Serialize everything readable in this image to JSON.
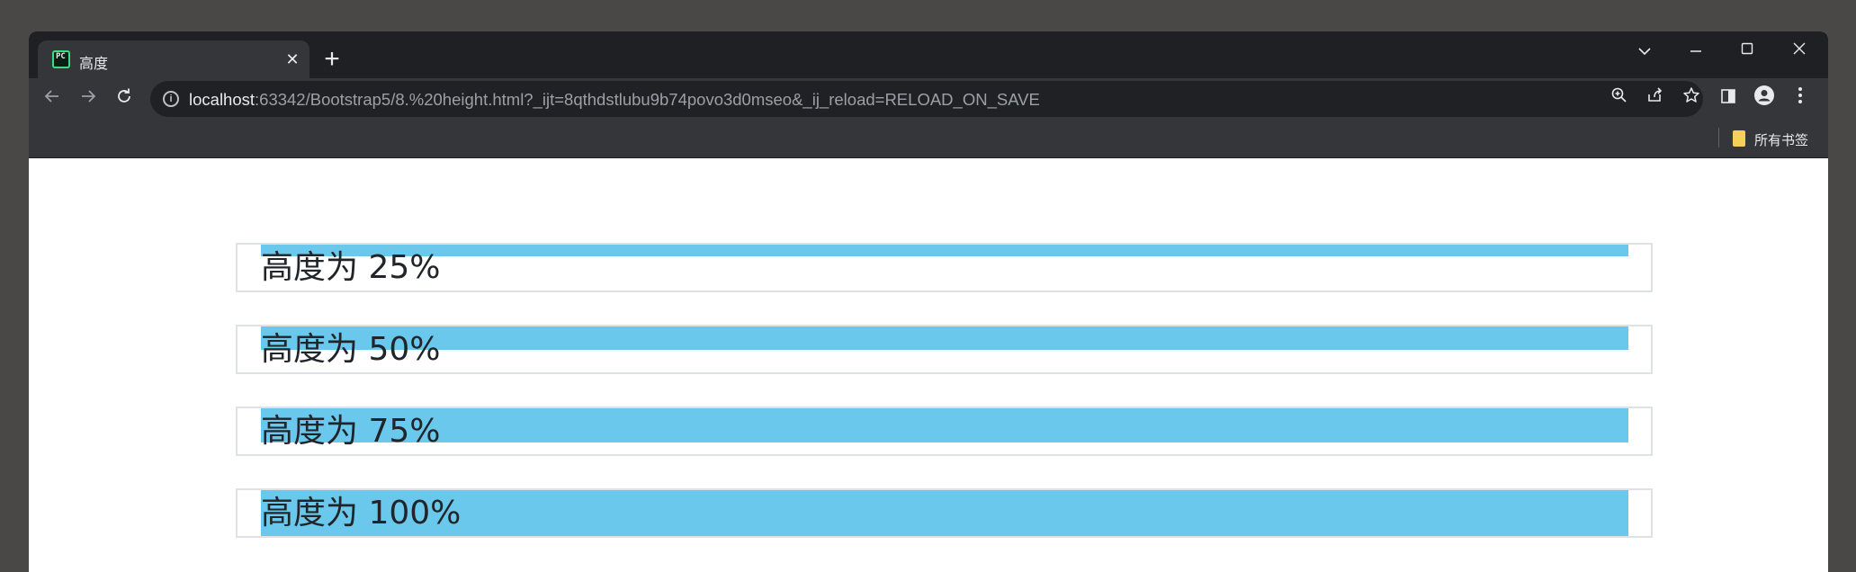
{
  "browser": {
    "tab_title": "高度",
    "tab_favicon_text": "PC",
    "tab_close_icon": "close-icon",
    "new_tab_symbol": "+",
    "url_host": "localhost",
    "url_rest": ":63342/Bootstrap5/8.%20height.html?_ijt=8qthdstlubu9b74povo3d0mseo&_ij_reload=RELOAD_ON_SAVE",
    "bookmarks_label": "所有书签"
  },
  "page": {
    "accent_color": "#6ac8ec",
    "rows": [
      {
        "label": "高度为 25%",
        "height_percent": 25
      },
      {
        "label": "高度为 50%",
        "height_percent": 50
      },
      {
        "label": "高度为 75%",
        "height_percent": 75
      },
      {
        "label": "高度为 100%",
        "height_percent": 100
      }
    ]
  }
}
